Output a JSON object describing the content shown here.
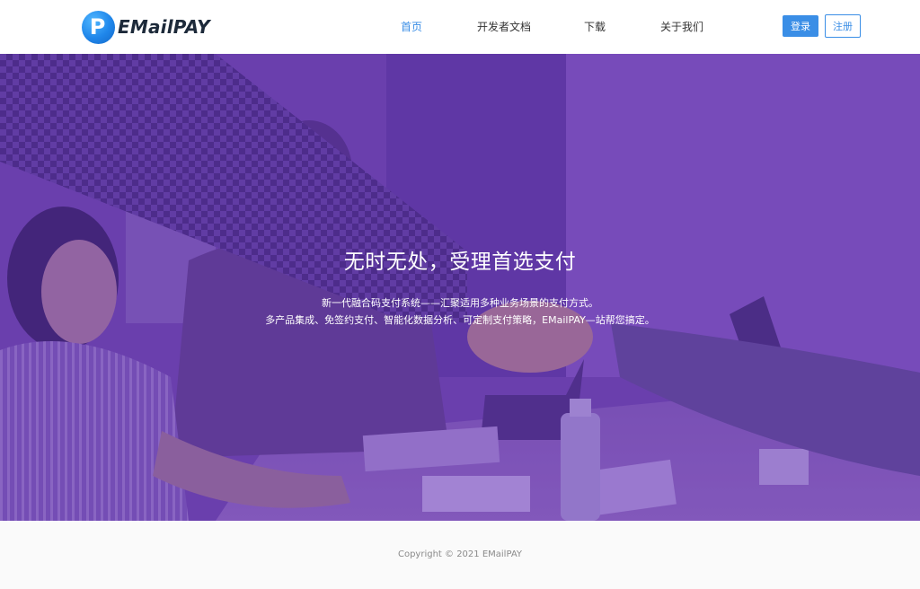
{
  "brand": {
    "logo_letter": "P",
    "name": "EMailPAY",
    "logo_color": "#1f86ea"
  },
  "nav": {
    "items": [
      {
        "label": "首页",
        "active": true
      },
      {
        "label": "开发者文档",
        "active": false
      },
      {
        "label": "下载",
        "active": false
      },
      {
        "label": "关于我们",
        "active": false
      }
    ]
  },
  "auth": {
    "login_label": "登录",
    "register_label": "注册",
    "accent_color": "#3a8ee6"
  },
  "hero": {
    "title": "无时无处，受理首选支付",
    "line1": "新一代融合码支付系统——汇聚适用多种业务场景的支付方式。",
    "line2": "多产品集成、免签约支付、智能化数据分析、可定制支付策略，EMailPAY—站帮您搞定。",
    "overlay_color": "#6a3bb0"
  },
  "footer": {
    "copyright": "Copyright © 2021 EMailPAY"
  }
}
